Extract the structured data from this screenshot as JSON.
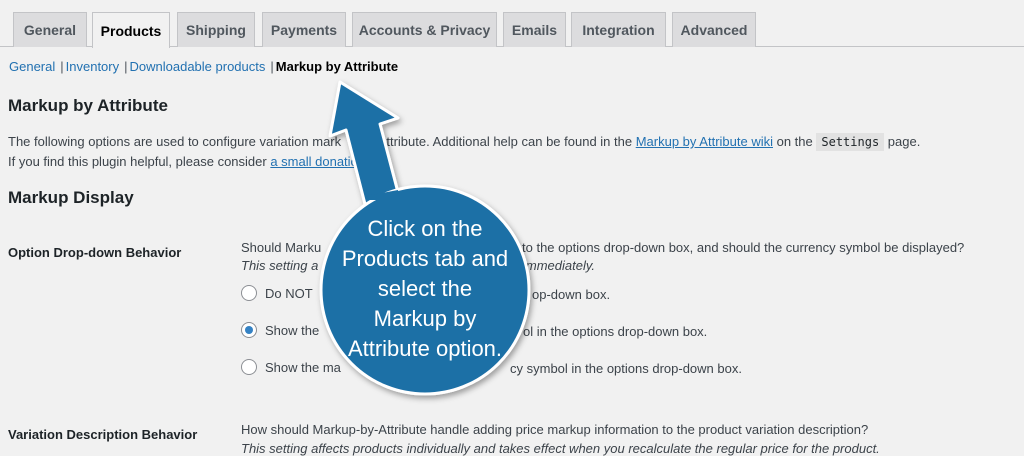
{
  "tabs": [
    {
      "label": "General"
    },
    {
      "label": "Products"
    },
    {
      "label": "Shipping"
    },
    {
      "label": "Payments"
    },
    {
      "label": "Accounts & Privacy"
    },
    {
      "label": "Emails"
    },
    {
      "label": "Integration"
    },
    {
      "label": "Advanced"
    }
  ],
  "active_tab": "Products",
  "subnav": {
    "general": "General",
    "inventory": "Inventory",
    "downloadable": "Downloadable products",
    "separator": "|",
    "current": "Markup by Attribute"
  },
  "section": {
    "title": "Markup by Attribute",
    "line1_a": "The following options are used to configure variation mark",
    "line1_b": "attribute. Additional help can be found in the ",
    "line1_link": "Markup by Attribute wiki",
    "line1_c": " on the ",
    "line1_code": "Settings",
    "line1_d": " page.",
    "line2_a": "If you find this plugin helpful, please consider ",
    "line2_link": "a small donatio"
  },
  "markup_display": {
    "title": "Markup Display",
    "option_dropdown": {
      "label": "Option Drop-down Behavior",
      "question_a": "Should Marku",
      "question_b": "to the options drop-down box, and should the currency symbol be displayed?",
      "note_a": "This setting a",
      "note_b": "immediately.",
      "radios": [
        {
          "label_a": "Do NOT",
          "label_b": "op-down box.",
          "checked": false
        },
        {
          "label_a": "Show the",
          "label_b": "ol in the options drop-down box.",
          "checked": true
        },
        {
          "label_a": "Show the ma",
          "label_b": "cy symbol in the options drop-down box.",
          "checked": false
        }
      ]
    },
    "variation_description": {
      "label": "Variation Description Behavior",
      "question": "How should Markup-by-Attribute handle adding price markup information to the product variation description?",
      "note": "This setting affects products individually and takes effect when you recalculate the regular price for the product."
    }
  },
  "callout": {
    "text": "Click on the\nProducts tab and\nselect the\nMarkup by\nAttribute option.",
    "color": "#1f6fa6"
  }
}
